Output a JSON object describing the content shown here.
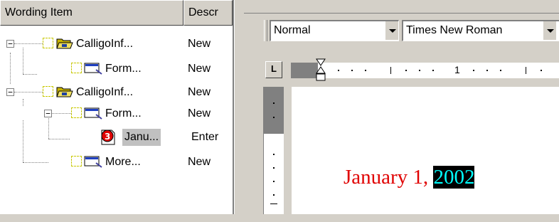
{
  "tree": {
    "columns": {
      "name": "Wording Item",
      "description": "Descr"
    },
    "rows": [
      {
        "label": "CalligoInf...",
        "description": "New",
        "type": "folder",
        "expanded": true
      },
      {
        "label": "Form...",
        "description": "New",
        "type": "form"
      },
      {
        "label": "CalligoInf...",
        "description": "New",
        "type": "folder",
        "expanded": true
      },
      {
        "label": "Form...",
        "description": "New",
        "type": "form",
        "expanded": true
      },
      {
        "label": "Janu...",
        "description": "Enter",
        "type": "field",
        "selected": true
      },
      {
        "label": "More...",
        "description": "New",
        "type": "form"
      }
    ]
  },
  "formatting": {
    "style": "Normal",
    "font": "Times New Roman"
  },
  "ruler": {
    "tab_stop": "L",
    "mark": "1"
  },
  "document": {
    "text_plain": "January 1, ",
    "text_selected": "2002"
  },
  "colors": {
    "doc_text": "#e00000",
    "selection_bg": "#000000",
    "selection_fg": "#00ffff"
  }
}
